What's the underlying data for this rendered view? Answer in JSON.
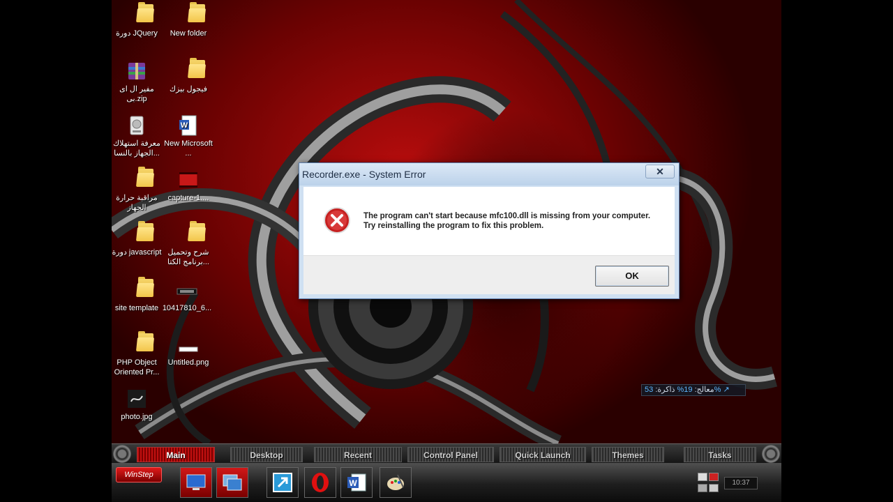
{
  "desktop": {
    "icons": [
      {
        "label": "دورة JQuery",
        "kind": "folder"
      },
      {
        "label": "New folder",
        "kind": "folder"
      },
      {
        "label": "مفير ال اى بى.zip",
        "kind": "zip"
      },
      {
        "label": "فيجول بيزك",
        "kind": "folder"
      },
      {
        "label": "معرفة استهلاك الجهاز بالنسا...",
        "kind": "app"
      },
      {
        "label": "New Microsoft ...",
        "kind": "word"
      },
      {
        "label": "مراقبة حرارة الجهاز",
        "kind": "folder"
      },
      {
        "label": "capture-1....",
        "kind": "video"
      },
      {
        "label": "دورة javascript",
        "kind": "folder"
      },
      {
        "label": "شرح وتحميل برنامج الكتا...",
        "kind": "folder-doc"
      },
      {
        "label": "site template",
        "kind": "folder"
      },
      {
        "label": "10417810_6...",
        "kind": "image"
      },
      {
        "label": "PHP Object Oriented Pr...",
        "kind": "folder"
      },
      {
        "label": "Untitled.png",
        "kind": "image"
      },
      {
        "label": "photo.jpg",
        "kind": "image"
      }
    ]
  },
  "dialog": {
    "title": "Recorder.exe - System Error",
    "close_label": "✕",
    "message": "The program can't start because mfc100.dll is missing from your computer. Try reinstalling the program to fix this problem.",
    "ok_label": "OK",
    "icon": "error-icon"
  },
  "perf_widget": {
    "cpu_label": "معالج:",
    "cpu_value": "19%",
    "memory_label": "ذاكرة:",
    "memory_value": "53%",
    "arrow": "↗"
  },
  "menubar": {
    "tabs": [
      {
        "label": "Main",
        "active": true
      },
      {
        "label": "Desktop",
        "active": false
      },
      {
        "label": "Recent",
        "active": false
      },
      {
        "label": "Control Panel",
        "active": false
      },
      {
        "label": "Quick Launch",
        "active": false
      },
      {
        "label": "Themes",
        "active": false
      },
      {
        "label": "Tasks",
        "active": false
      }
    ]
  },
  "launchbar": {
    "winstep_label": "WinStep",
    "clock": "10:37",
    "apps": [
      "monitor-icon",
      "windows-icon",
      "shortcut-icon",
      "opera-icon",
      "word-icon",
      "paint-icon"
    ]
  },
  "colors": {
    "accent_red": "#c01010",
    "dialog_border": "#5c7fae",
    "perf_value": "#5fb7ff"
  }
}
